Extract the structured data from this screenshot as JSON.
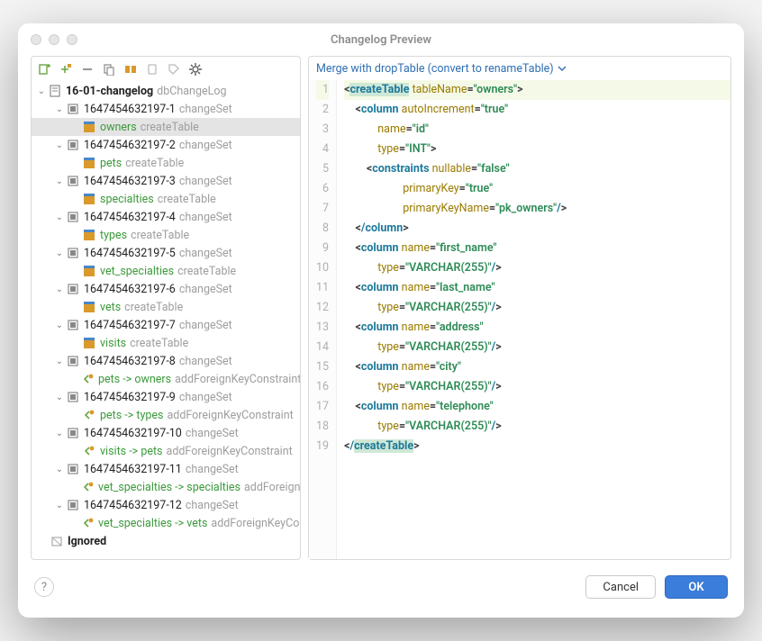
{
  "window": {
    "title": "Changelog Preview"
  },
  "merge_link": "Merge with dropTable (convert to renameTable)",
  "buttons": {
    "cancel": "Cancel",
    "ok": "OK"
  },
  "tree": {
    "root": {
      "name": "16-01-changelog",
      "type": "dbChangeLog"
    },
    "n1": {
      "name": "1647454632197-1",
      "type": "changeSet"
    },
    "n1a": {
      "name": "owners",
      "type": "createTable"
    },
    "n2": {
      "name": "1647454632197-2",
      "type": "changeSet"
    },
    "n2a": {
      "name": "pets",
      "type": "createTable"
    },
    "n3": {
      "name": "1647454632197-3",
      "type": "changeSet"
    },
    "n3a": {
      "name": "specialties",
      "type": "createTable"
    },
    "n4": {
      "name": "1647454632197-4",
      "type": "changeSet"
    },
    "n4a": {
      "name": "types",
      "type": "createTable"
    },
    "n5": {
      "name": "1647454632197-5",
      "type": "changeSet"
    },
    "n5a": {
      "name": "vet_specialties",
      "type": "createTable"
    },
    "n6": {
      "name": "1647454632197-6",
      "type": "changeSet"
    },
    "n6a": {
      "name": "vets",
      "type": "createTable"
    },
    "n7": {
      "name": "1647454632197-7",
      "type": "changeSet"
    },
    "n7a": {
      "name": "visits",
      "type": "createTable"
    },
    "n8": {
      "name": "1647454632197-8",
      "type": "changeSet"
    },
    "n8a": {
      "name": "pets -> owners",
      "type": "addForeignKeyConstraint"
    },
    "n9": {
      "name": "1647454632197-9",
      "type": "changeSet"
    },
    "n9a": {
      "name": "pets -> types",
      "type": "addForeignKeyConstraint"
    },
    "n10": {
      "name": "1647454632197-10",
      "type": "changeSet"
    },
    "n10a": {
      "name": "visits -> pets",
      "type": "addForeignKeyConstraint"
    },
    "n11": {
      "name": "1647454632197-11",
      "type": "changeSet"
    },
    "n11a": {
      "name": "vet_specialties -> specialties",
      "type": "addForeignKeyConstraint"
    },
    "n12": {
      "name": "1647454632197-12",
      "type": "changeSet"
    },
    "n12a": {
      "name": "vet_specialties -> vets",
      "type": "addForeignKeyConstraint"
    },
    "ignored": {
      "name": "Ignored"
    }
  },
  "code": {
    "tableName": "owners",
    "autoIncrement": "true",
    "id_name": "id",
    "id_type": "INT",
    "nullable": "false",
    "primaryKey": "true",
    "primaryKeyName": "pk_owners",
    "cols": {
      "first_name": "VARCHAR(255)",
      "last_name": "VARCHAR(255)",
      "address": "VARCHAR(255)",
      "city": "VARCHAR(255)",
      "telephone": "VARCHAR(255)"
    },
    "lines": 19
  },
  "chart_data": null
}
